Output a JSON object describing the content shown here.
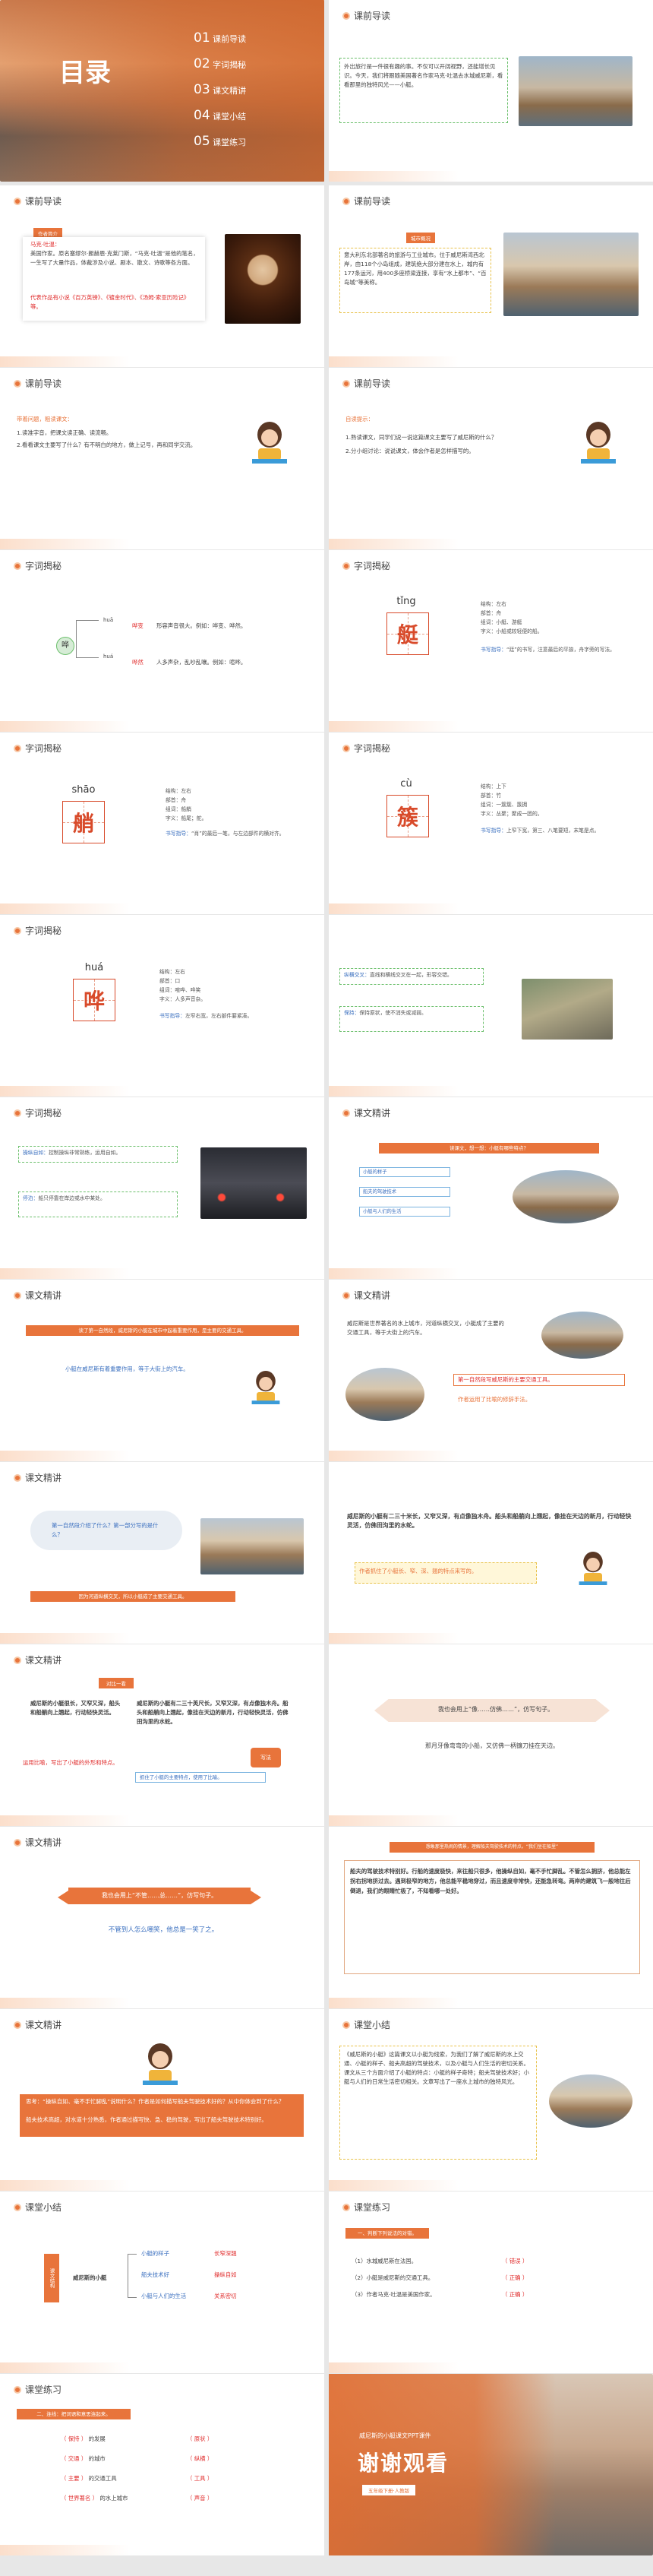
{
  "toc": {
    "title": "目录",
    "items": [
      {
        "num": "01",
        "label": "课前导读"
      },
      {
        "num": "02",
        "label": "字词揭秘"
      },
      {
        "num": "03",
        "label": "课文精讲"
      },
      {
        "num": "04",
        "label": "课堂小结"
      },
      {
        "num": "05",
        "label": "课堂练习"
      }
    ]
  },
  "sections": {
    "s1": "课前导读",
    "s2": "字词揭秘",
    "s3": "课文精讲",
    "s4": "课堂小结",
    "s5": "课堂练习"
  },
  "intro1": {
    "text": "外出旅行是一件很有趣的事。不仅可以开阔视野，还能增长见识。今天，我们将跟随美国著名作家马克·吐温去水城威尼斯，看看那里的独特风光——小艇。"
  },
  "author": {
    "tag": "作者简介",
    "name": "马克·吐温：",
    "text": "美国作家。原名塞缪尔·朗赫恩·克莱门斯，“马克·吐温”是他的笔名，一生写了大量作品，体裁涉及小说、剧本、散文、诗歌等各方面。",
    "works": "代表作品有小说《百万英镑》、《镀金时代》、《汤姆·索亚历险记》等。"
  },
  "city": {
    "tag": "城市概况",
    "text": "意大利东北部著名的旅游与工业城市。位于威尼斯湾西北岸，由118个小岛组成，建筑绝大部分建在水上，城内有177条运河，用400多座桥梁连接，享有“水上都市”、“百岛城”等美称。"
  },
  "read1": {
    "q": "带着问题，粗读课文：",
    "a1": "1.读准字音，把课文读正确、读流畅。",
    "a2": "2.看看课文主要写了什么？有不明白的地方，做上记号，再和同学交流。"
  },
  "read2": {
    "q": "自读提示：",
    "a1": "1.熟读课文，同学们说一说这篇课文主要写了威尼斯的什么？",
    "a2": "2.分小组讨论：说说课文，体会作者是怎样描写的。"
  },
  "word_hua": {
    "char": "哗",
    "r1py": "huā",
    "r1w": "哗变",
    "r1t": "形容声音很大。例如：哗变、哗然。",
    "r2py": "huá",
    "r2w": "哗然",
    "r2t": "人多声杂，乱吵乱嚷。例如：喧哗。"
  },
  "word_ting": {
    "py": "tǐng",
    "char": "艇",
    "jg": "结构：左右",
    "bs": "部首：舟",
    "zc": "组词：小艇、游艇",
    "zy": "字义：小船或较轻便的船。",
    "tip_label": "书写指导：",
    "tip": "“廷”的书写，注意最后的平捺，舟字旁的写法。"
  },
  "word_shao": {
    "py": "shāo",
    "char": "艄",
    "jg": "结构：左右",
    "bs": "部首：舟",
    "zc": "组词：船艄",
    "zy": "字义：船尾；舵。",
    "tip_label": "书写指导：",
    "tip": "“肖”的最后一笔，与左边部件的横对齐。"
  },
  "word_cu": {
    "py": "cù",
    "char": "簇",
    "jg": "结构：上下",
    "bs": "部首：竹",
    "zc": "组词：一簇簇、簇拥",
    "zy": "字义：丛聚；聚成一团的。",
    "tip_label": "书写指导：",
    "tip": "上窄下宽，第三、八笔要短，末笔是点。"
  },
  "word_hua2": {
    "py": "huá",
    "char": "哗",
    "jg": "结构：左右",
    "bs": "部首：口",
    "zc": "组词：喧哗、哗笑",
    "zy": "字义：人多声音杂。",
    "tip_label": "书写指导：",
    "tip": "左窄右宽，左右部件要紧凑。"
  },
  "vocab1": {
    "a_label": "纵横交叉：",
    "a": "直线和横线交叉在一起，形容交错。",
    "b_label": "保持：",
    "b": "保持原状，使不消失或减弱。"
  },
  "vocab2": {
    "a_label": "操纵自如：",
    "a": "控制操纵非常熟练，运用自如。",
    "b_label": "停泊：",
    "b": "船只停靠在岸边或水中某处。"
  },
  "text1": {
    "banner": "读课文，想一想：小艇有哪些特点？",
    "pills": [
      "小艇的样子",
      "船夫的驾驶技术",
      "小艇与人们的生活"
    ]
  },
  "text2": {
    "p": "威尼斯是世界著名的水上城市，河道纵横交叉，小艇成了主要的交通工具，等于大街上的汽车。",
    "b1": "第一自然段写威尼斯的主要交通工具。",
    "b2": "作者运用了比喻的修辞手法。"
  },
  "text3": {
    "banner": "读了第一自然段，威尼斯的小艇在城市中起着重要作用，是主要的交通工具。",
    "q": "小艇在威尼斯有着重要作用，等于大街上的汽车。"
  },
  "text4": {
    "cloud": "第一自然段介绍了什么？第一部分写的是什么？",
    "banner": "因为河道纵横交叉，所以小艇成了主要交通工具。"
  },
  "text5": {
    "p": "威尼斯的小艇有二三十米长，又窄又深，有点像独木舟。船头和船艄向上翘起，像挂在天边的新月，行动轻快灵活，仿佛田沟里的水蛇。",
    "hint": "作者抓住了小艇长、窄、深、翘的特点来写的。"
  },
  "text6": {
    "tag": "对比一看",
    "l": "威尼斯的小艇很长，又窄又深，船头和船艄向上翘起，行动轻快灵活。",
    "r": "威尼斯的小艇有二三十英尺长，又窄又深，有点像独木舟。船头和船艄向上翘起，像挂在天边的新月，行动轻快灵活，仿佛田沟里的水蛇。",
    "note": "运用比喻，写出了小艇的外形和特点。",
    "foot": "抓住了小艇的主要特点，使用了比喻。",
    "badge": "写法"
  },
  "text7": {
    "banner": "我也会用上“像……仿佛……”，仿写句子。",
    "s": "那月牙像弯弯的小船，又仿佛一柄镰刀挂在天边。"
  },
  "text8": {
    "banner": "我也会用上“不管……总……”，仿写句子。",
    "s": "不管到人怎么嘲笑，他总是一笑了之。"
  },
  "text9": {
    "banner": "想象那里热闹的情景，理解船夫驾驶技术的特点。“我们坐在船里”",
    "p": "船夫的驾驶技术特别好。行船的速度极快，来往船只很多，他操纵自如，毫不手忙脚乱。不管怎么拥挤，他总能左拐右拐地挤过去。遇到极窄的地方，他总能平稳地穿过，而且速度非常快，还能急转弯。两岸的建筑飞一般地往后倒退，我们的眼睛忙极了，不知看哪一处好。"
  },
  "text10": {
    "banner": "思考：“操纵自如、毫不手忙脚乱”说明什么？作者是如何描写船夫驾驶技术好的？从中你体会到了什么？",
    "ans": "船夫技术高超，对水道十分熟悉，作者通过描写快、急、稳的驾驶，写出了船夫驾驶技术特别好。"
  },
  "summary1": {
    "text": "《威尼斯的小艇》这篇课文以小艇为线索，为我们了解了威尼斯的水上交通、小艇的样子、船夫高超的驾驶技术，以及小艇与人们生活的密切关系。课文从三个方面介绍了小艇的特点：小艇的样子奇特；船夫驾驶技术好；小艇与人们的日常生活密切相关。文章写出了一座水上城市的独特风光。"
  },
  "summary2": {
    "root": "威尼斯的小艇",
    "left_tag": "课文结构",
    "items": [
      {
        "a": "小艇的样子",
        "b": "长窄深翘"
      },
      {
        "a": "船夫技术好",
        "b": "操纵自如"
      },
      {
        "a": "小艇与人们的生活",
        "b": "关系密切"
      }
    ]
  },
  "ex1": {
    "tag": "一、判断下列说法的对错。",
    "items": [
      {
        "q": "（1）水城威尼斯在法国。",
        "a": "（ 错误 ）"
      },
      {
        "q": "（2）小艇是威尼斯的交通工具。",
        "a": "（ 正确 ）"
      },
      {
        "q": "（3）作者马克·吐温是美国作家。",
        "a": "（ 正确 ）"
      }
    ]
  },
  "ex2": {
    "tag": "二、连线：把词语和意思连起来。",
    "left": [
      {
        "w": "（ 保持 ）",
        "t": "的发展"
      },
      {
        "w": "（ 交通 ）",
        "t": "的城市"
      },
      {
        "w": "（ 主要 ）",
        "t": "的交通工具"
      },
      {
        "w": "（ 世界著名 ）",
        "t": "的水上城市"
      }
    ],
    "right": [
      "（ 原状 ）",
      "（ 纵横 ）",
      "（ 工具 ）",
      "（ 声音 ）"
    ]
  },
  "end": {
    "sub": "威尼斯的小艇课文PPT课件",
    "title": "谢谢观看",
    "badge": "五年级下册·人教版"
  }
}
